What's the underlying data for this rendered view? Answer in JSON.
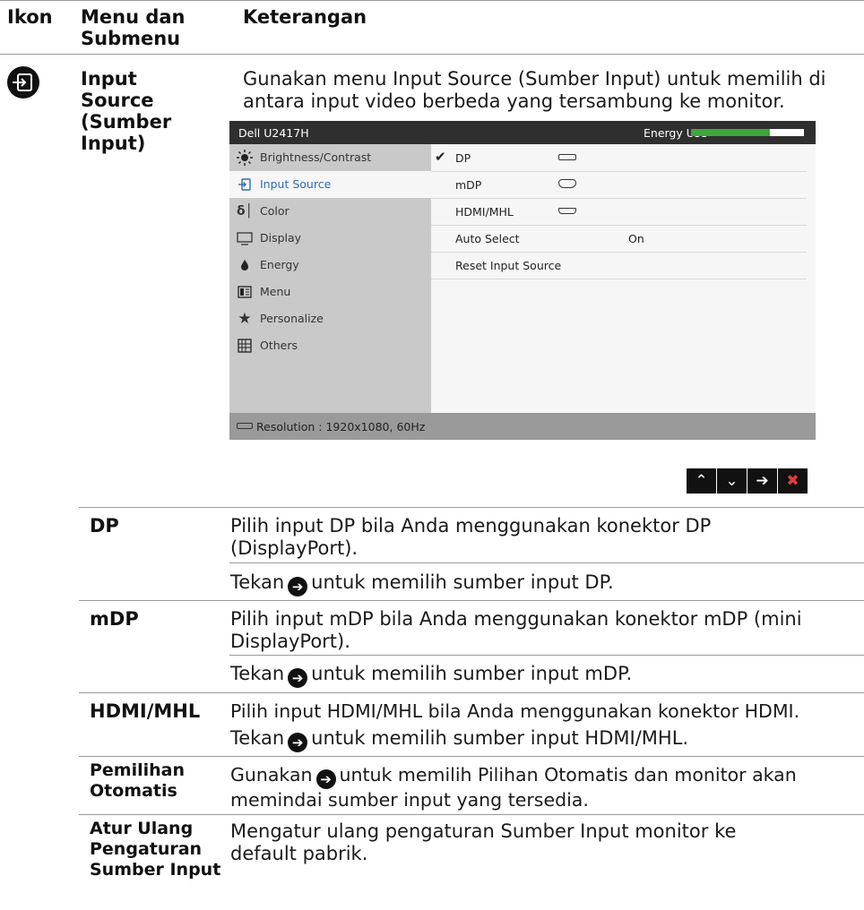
{
  "headers": {
    "icon": "Ikon",
    "menu": "Menu dan Submenu",
    "desc": "Keterangan"
  },
  "section": {
    "icon": "input-source-icon",
    "title": "Input Source (Sumber Input)",
    "description": "Gunakan menu Input Source (Sumber Input) untuk memilih di antara input video berbeda yang tersambung ke monitor."
  },
  "osd": {
    "model": "Dell U2417H",
    "energy_label": "Energy Use",
    "energy_level": 0.7,
    "energy_color": "#3fa53c",
    "menu": [
      {
        "label": "Brightness/Contrast",
        "icon": "brightness-icon"
      },
      {
        "label": "Input Source",
        "icon": "input-source-icon"
      },
      {
        "label": "Color",
        "icon": "color-icon"
      },
      {
        "label": "Display",
        "icon": "display-icon"
      },
      {
        "label": "Energy",
        "icon": "energy-icon"
      },
      {
        "label": "Menu",
        "icon": "menu-icon"
      },
      {
        "label": "Personalize",
        "icon": "star-icon"
      },
      {
        "label": "Others",
        "icon": "others-icon"
      }
    ],
    "selected_menu": "Input Source",
    "options": [
      {
        "label": "DP",
        "checked": true,
        "port": "dp"
      },
      {
        "label": "mDP",
        "port": "mdp"
      },
      {
        "label": "HDMI/MHL",
        "port": "hdmi"
      },
      {
        "label": "Auto Select",
        "value": "On"
      },
      {
        "label": "Reset Input Source"
      }
    ],
    "resolution": "Resolution : 1920x1080, 60Hz"
  },
  "nav_buttons": [
    "up-icon",
    "down-icon",
    "right-arrow-icon",
    "close-icon"
  ],
  "rows": [
    {
      "name": "DP",
      "lines": [
        "Pilih input DP bila Anda menggunakan konektor DP (DisplayPort)."
      ],
      "press_pre": "Tekan",
      "press_post": "untuk memilih sumber input DP."
    },
    {
      "name": "mDP",
      "lines": [
        "Pilih input mDP bila Anda menggunakan konektor mDP (mini DisplayPort)."
      ],
      "press_pre": "Tekan",
      "press_post": "untuk memilih sumber input mDP."
    },
    {
      "name": "HDMI/MHL",
      "lines": [
        "Pilih input HDMI/MHL bila Anda menggunakan konektor HDMI."
      ],
      "press_pre": "Tekan",
      "press_post": "untuk memilih sumber input HDMI/MHL."
    },
    {
      "name": "Pemilihan Otomatis",
      "press_pre": "Gunakan",
      "press_post": "untuk memilih Pilihan Otomatis dan monitor akan memindai sumber input yang tersedia."
    },
    {
      "name": "Atur Ulang Pengaturan Sumber Input",
      "lines": [
        "Mengatur ulang pengaturan Sumber Input monitor ke default pabrik."
      ]
    }
  ]
}
